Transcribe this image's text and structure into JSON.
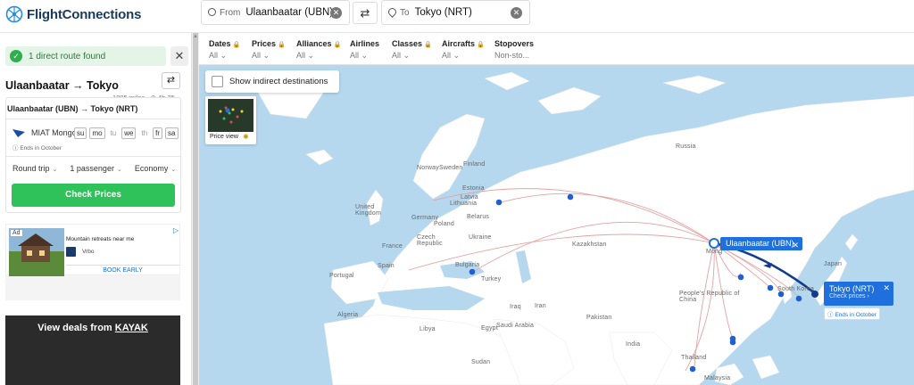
{
  "brand": {
    "name": "FlightConnections"
  },
  "search": {
    "from_label": "From",
    "from_value": "Ulaanbaatar (UBN)",
    "to_label": "To",
    "to_value": "Tokyo (NRT)"
  },
  "sidebar": {
    "route_found": "1 direct route found",
    "route_title": "Ulaanbaatar → Tokyo",
    "distance": "1895 miles",
    "duration": "4h 35",
    "route_line": "Ulaanbaatar (UBN) → Tokyo (NRT)",
    "airline": "MIAT Mongo",
    "days": [
      {
        "d": "su",
        "on": true
      },
      {
        "d": "mo",
        "on": true
      },
      {
        "d": "tu",
        "on": false
      },
      {
        "d": "we",
        "on": true
      },
      {
        "d": "th",
        "on": false
      },
      {
        "d": "fr",
        "on": true
      },
      {
        "d": "sa",
        "on": true
      }
    ],
    "ends_note": "Ends in October",
    "trip_type": "Round trip",
    "passengers": "1 passenger",
    "cabin": "Economy",
    "check_prices": "Check Prices"
  },
  "ad": {
    "badge": "Ad",
    "title": "Mountain retreats near me",
    "brand": "Vrbo",
    "cta": "BOOK EARLY"
  },
  "kayak": {
    "text_prefix": "View deals from",
    "brand": "KAYAK"
  },
  "filters": [
    {
      "name": "Dates",
      "value": "All",
      "locked": true
    },
    {
      "name": "Prices",
      "value": "All",
      "locked": true
    },
    {
      "name": "Alliances",
      "value": "All",
      "locked": true
    },
    {
      "name": "Airlines",
      "value": "All",
      "locked": false
    },
    {
      "name": "Classes",
      "value": "All",
      "locked": true
    },
    {
      "name": "Aircrafts",
      "value": "All",
      "locked": true
    },
    {
      "name": "Stopovers",
      "value": "Non-sto...",
      "locked": false
    }
  ],
  "map": {
    "indirect_label": "Show indirect destinations",
    "price_view_label": "Price view",
    "origin_popup": "Ulaanbaatar (UBN)",
    "dest_popup_title": "Tokyo (NRT)",
    "dest_popup_sub": "Check prices",
    "dest_ends": "Ends in October",
    "labels": {
      "russia": "Russia",
      "united_kingdom": "United Kingdom",
      "poland": "Poland",
      "ukraine": "Ukraine",
      "kazakhstan": "Kazakhstan",
      "france": "France",
      "spain": "Spain",
      "portugal": "Portugal",
      "algeria": "Algeria",
      "turkey": "Turkey",
      "iran": "Iran",
      "egypt": "Egypt",
      "saudi_arabia": "Saudi Arabia",
      "china": "People's Republic of China",
      "mongolia": "Mong",
      "south_korea": "South Korea",
      "libya": "Libya",
      "sudan": "Sudan",
      "bulgaria": "Bulgaria",
      "germany": "Germany",
      "iraq": "Iraq",
      "pakistan": "Pakistan",
      "india": "India",
      "thailand": "Thailand",
      "czech_republic": "Czech Republic",
      "malaysia": "Malaysia",
      "sweden": "Sweden",
      "norway": "Norway",
      "finland": "Finland",
      "estonia": "Estonia",
      "latvia": "Latvia",
      "lithuania": "Lithuania",
      "belarus": "Belarus",
      "japan": "Japan"
    }
  }
}
